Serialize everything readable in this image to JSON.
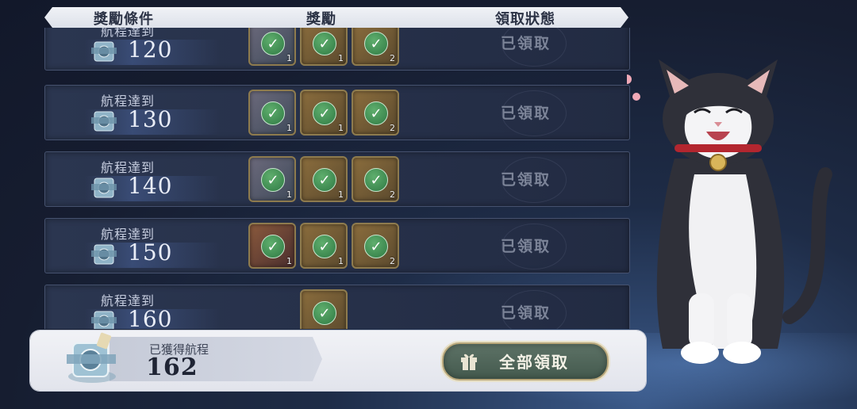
{
  "header": {
    "col_condition": "獎勵條件",
    "col_reward": "獎勵",
    "col_status": "領取狀態"
  },
  "rows": [
    {
      "condition_label": "航程達到",
      "value": "120",
      "rewards": [
        {
          "qty": "1"
        },
        {
          "qty": "1"
        },
        {
          "qty": "2"
        }
      ],
      "status": "已領取"
    },
    {
      "condition_label": "航程達到",
      "value": "130",
      "rewards": [
        {
          "qty": "1"
        },
        {
          "qty": "1"
        },
        {
          "qty": "2"
        }
      ],
      "status": "已領取"
    },
    {
      "condition_label": "航程達到",
      "value": "140",
      "rewards": [
        {
          "qty": "1"
        },
        {
          "qty": "1"
        },
        {
          "qty": "2"
        }
      ],
      "status": "已領取"
    },
    {
      "condition_label": "航程達到",
      "value": "150",
      "rewards": [
        {
          "qty": "1"
        },
        {
          "qty": "1"
        },
        {
          "qty": "2"
        }
      ],
      "status": "已領取"
    },
    {
      "condition_label": "航程達到",
      "value": "160",
      "rewards": [
        {
          "qty": ""
        }
      ],
      "status": "已領取"
    }
  ],
  "footer": {
    "earned_label": "已獲得航程",
    "earned_value": "162",
    "claim_all_label": "全部領取"
  },
  "icons": {
    "check": "✓",
    "reward_item": "reward-item-icon",
    "film_reel": "film-reel-icon",
    "gift": "gift-icon",
    "cat": "cat-mascot"
  },
  "colors": {
    "claim_button": "#4f6558",
    "checkmark": "#3a8a52",
    "slot_border": "#8e7b4e"
  }
}
